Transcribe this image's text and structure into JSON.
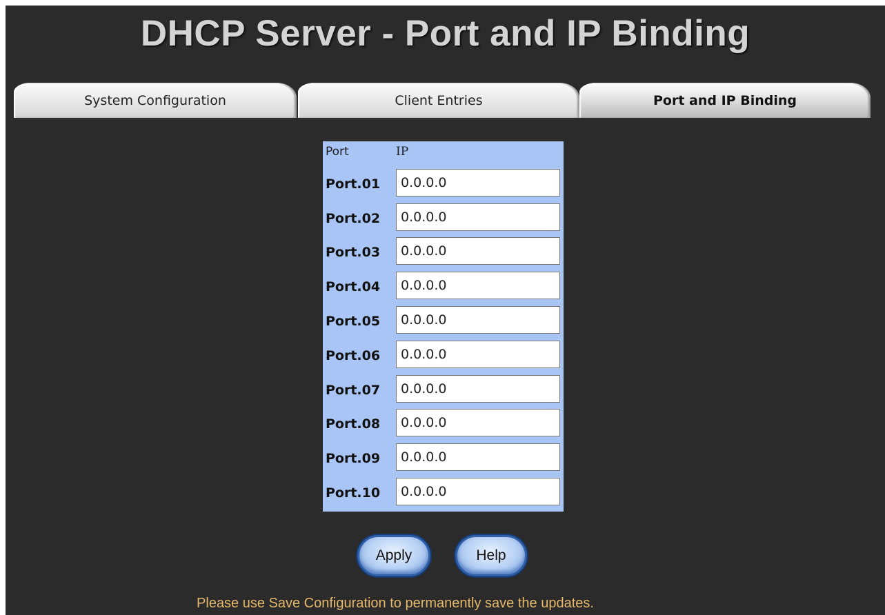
{
  "page": {
    "title": "DHCP Server - Port and IP Binding"
  },
  "tabs": [
    {
      "label": "System Configuration",
      "active": false
    },
    {
      "label": "Client Entries",
      "active": false
    },
    {
      "label": "Port and IP Binding",
      "active": true
    }
  ],
  "table": {
    "headers": {
      "port": "Port",
      "ip": "IP"
    },
    "rows": [
      {
        "port": "Port.01",
        "ip": "0.0.0.0"
      },
      {
        "port": "Port.02",
        "ip": "0.0.0.0"
      },
      {
        "port": "Port.03",
        "ip": "0.0.0.0"
      },
      {
        "port": "Port.04",
        "ip": "0.0.0.0"
      },
      {
        "port": "Port.05",
        "ip": "0.0.0.0"
      },
      {
        "port": "Port.06",
        "ip": "0.0.0.0"
      },
      {
        "port": "Port.07",
        "ip": "0.0.0.0"
      },
      {
        "port": "Port.08",
        "ip": "0.0.0.0"
      },
      {
        "port": "Port.09",
        "ip": "0.0.0.0"
      },
      {
        "port": "Port.10",
        "ip": "0.0.0.0"
      }
    ]
  },
  "buttons": {
    "apply": "Apply",
    "help": "Help"
  },
  "note": "Please use Save Configuration to permanently save the updates.",
  "colors": {
    "background": "#2b2b2b",
    "table_header": "#a9c5f5",
    "note_text": "#e6b86a",
    "title_text": "#d4d4d4"
  }
}
